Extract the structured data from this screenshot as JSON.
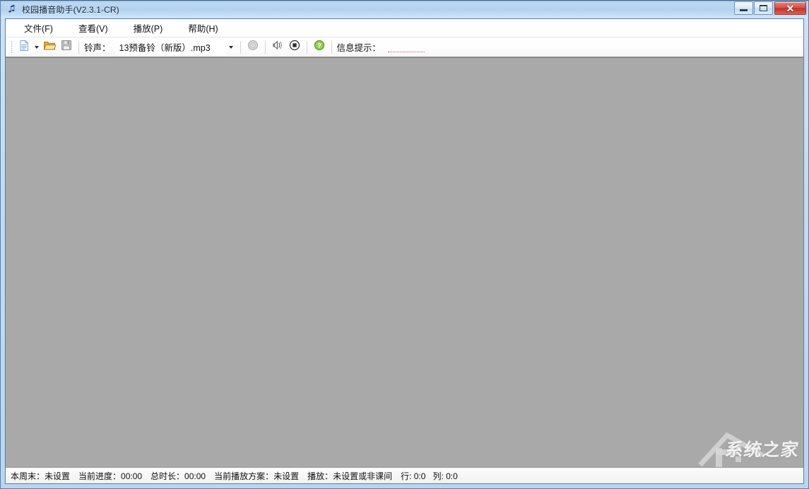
{
  "window": {
    "title": "校园播音助手(V2.3.1-CR)",
    "app_icon": "music-note-icon",
    "controls": {
      "minimize_label": "—",
      "maximize_label": "□",
      "close_label": "✕"
    },
    "colors": {
      "titlebar_blue": "#b4d2ef",
      "frame_border": "#5b7fa6",
      "close_red": "#c0302a",
      "canvas_gray": "#a9a9a9",
      "help_green": "#8dc63f",
      "folder_yellow": "#f0c14b"
    }
  },
  "menubar": {
    "items": [
      {
        "label": "文件(F)",
        "name": "menu-file"
      },
      {
        "label": "查看(V)",
        "name": "menu-view"
      },
      {
        "label": "播放(P)",
        "name": "menu-play"
      },
      {
        "label": "帮助(H)",
        "name": "menu-help"
      }
    ]
  },
  "toolbar": {
    "new_icon": "new-document-icon",
    "new_dropdown_icon": "chevron-down-icon",
    "open_icon": "open-folder-icon",
    "save_icon": "save-disk-icon",
    "ring_label": "铃声：",
    "ring_value": "13预备铃（新版）.mp3",
    "ring_dropdown_icon": "chevron-down-icon",
    "disc_icon": "disc-icon",
    "horn_icon": "horn-speaker-icon",
    "stop_icon": "stop-button-icon",
    "help_icon": "help-question-icon",
    "info_label": "信息提示：",
    "info_value": ""
  },
  "statusbar": {
    "segments": [
      {
        "name": "status-weekend",
        "text": "本周末：未设置"
      },
      {
        "name": "status-progress",
        "text": "当前进度：00:00"
      },
      {
        "name": "status-duration",
        "text": "总时长：00:00"
      },
      {
        "name": "status-scheme",
        "text": "当前播放方案：未设置"
      },
      {
        "name": "status-playback",
        "text": "播放：未设置或非课间"
      },
      {
        "name": "status-row",
        "text": "行: 0:0"
      },
      {
        "name": "status-col",
        "text": "列: 0:0"
      }
    ]
  },
  "watermark": {
    "text": "系统之家"
  }
}
